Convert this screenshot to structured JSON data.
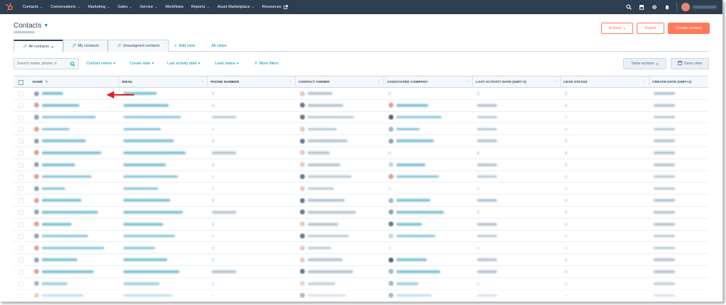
{
  "nav": {
    "items": [
      {
        "label": "Contacts",
        "caret": true
      },
      {
        "label": "Conversations",
        "caret": true
      },
      {
        "label": "Marketing",
        "caret": true
      },
      {
        "label": "Sales",
        "caret": true
      },
      {
        "label": "Service",
        "caret": true
      },
      {
        "label": "Workflows",
        "caret": false
      },
      {
        "label": "Reports",
        "caret": true
      },
      {
        "label": "Asset Marketplace",
        "caret": true
      },
      {
        "label": "Resources",
        "caret": false,
        "external": true
      }
    ],
    "icons": [
      "search-icon",
      "marketplace-icon",
      "gear-icon",
      "bell-icon"
    ]
  },
  "header": {
    "title": "Contacts",
    "actions_label": "Actions",
    "import_label": "Import",
    "create_label": "Create contact"
  },
  "tabs": {
    "all": "All contacts",
    "mine": "My contacts",
    "unassigned": "Unassigned contacts",
    "add_view": "Add view",
    "all_views": "All views"
  },
  "filters": {
    "search_placeholder": "Search name, phone, e",
    "contact_owner": "Contact owner",
    "create_date": "Create date",
    "last_activity": "Last activity date",
    "lead_status": "Lead status",
    "more_filters": "More filters",
    "table_actions": "Table actions",
    "save_view": "Save view"
  },
  "table": {
    "columns": [
      "NAME",
      "EMAIL",
      "PHONE NUMBER",
      "CONTACT OWNER",
      "ASSOCIATED COMPANY",
      "LAST ACTIVITY DATE (GMT+1)",
      "LEAD STATUS",
      "CREATE DATE (GMT+1)"
    ],
    "row_count": 18
  },
  "colors": {
    "nav_bg": "#2d3e50",
    "accent": "#ff7a59",
    "link": "#0091ae",
    "arrow": "#e01f26"
  }
}
